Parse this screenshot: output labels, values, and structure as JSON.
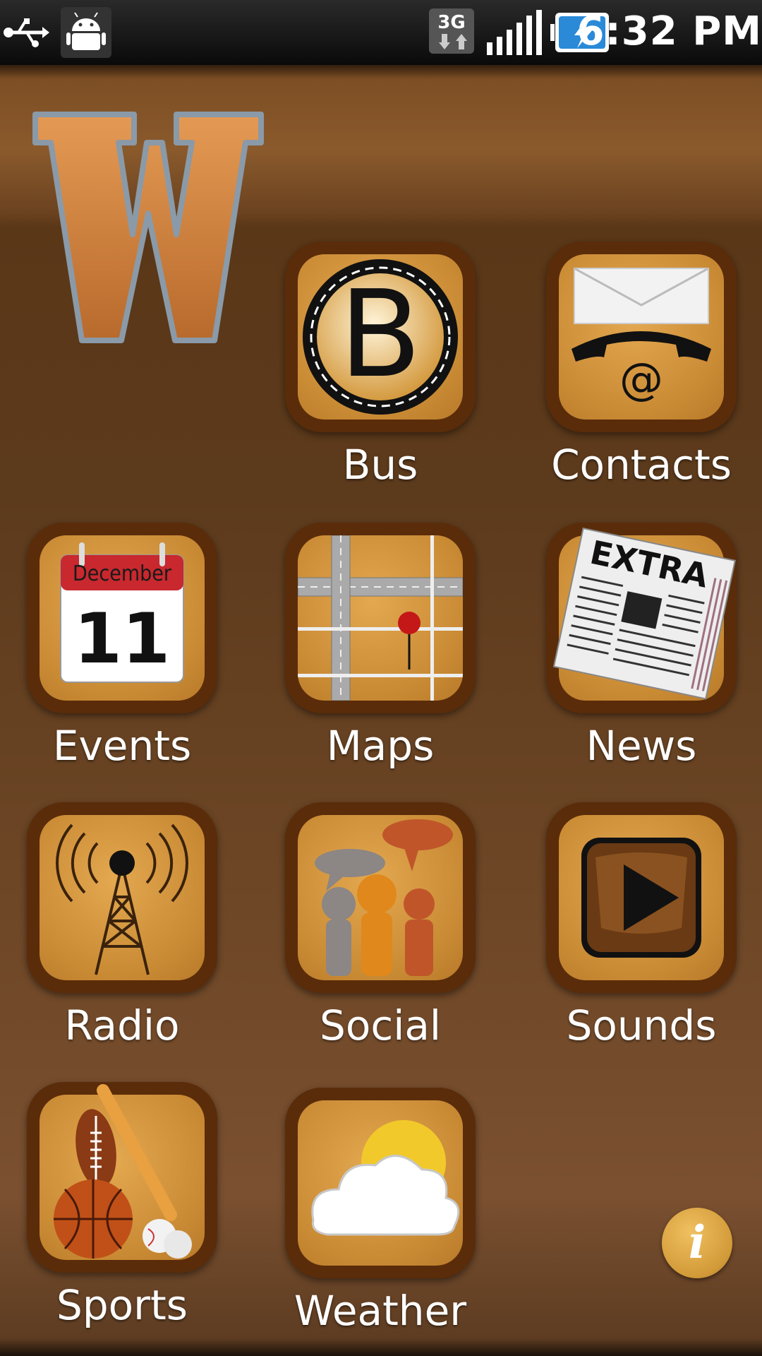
{
  "status_bar": {
    "time": "6:32 PM",
    "network": "3G",
    "icons": [
      "usb-icon",
      "android-debug-icon",
      "3g-icon",
      "signal-icon",
      "battery-charging-icon"
    ]
  },
  "logo": {
    "letter": "W"
  },
  "tiles": [
    {
      "id": "bus",
      "label": "Bus",
      "icon": "bus-icon"
    },
    {
      "id": "contacts",
      "label": "Contacts",
      "icon": "contacts-icon"
    },
    {
      "id": "events",
      "label": "Events",
      "icon": "calendar-icon",
      "calendar_month": "December",
      "calendar_day": "11"
    },
    {
      "id": "maps",
      "label": "Maps",
      "icon": "map-icon"
    },
    {
      "id": "news",
      "label": "News",
      "icon": "newspaper-icon",
      "headline": "EXTRA"
    },
    {
      "id": "radio",
      "label": "Radio",
      "icon": "radio-tower-icon"
    },
    {
      "id": "social",
      "label": "Social",
      "icon": "social-icon"
    },
    {
      "id": "sounds",
      "label": "Sounds",
      "icon": "play-icon"
    },
    {
      "id": "sports",
      "label": "Sports",
      "icon": "sports-icon"
    },
    {
      "id": "weather",
      "label": "Weather",
      "icon": "weather-icon"
    }
  ],
  "info_button": {
    "symbol": "i",
    "icon": "info-icon"
  },
  "contacts_icon_symbol": "@",
  "bus_icon_letter": "B",
  "colors": {
    "tile_border": "#5a2c0a",
    "tile_face": "#c98a34",
    "background": "#5c3a1c"
  }
}
